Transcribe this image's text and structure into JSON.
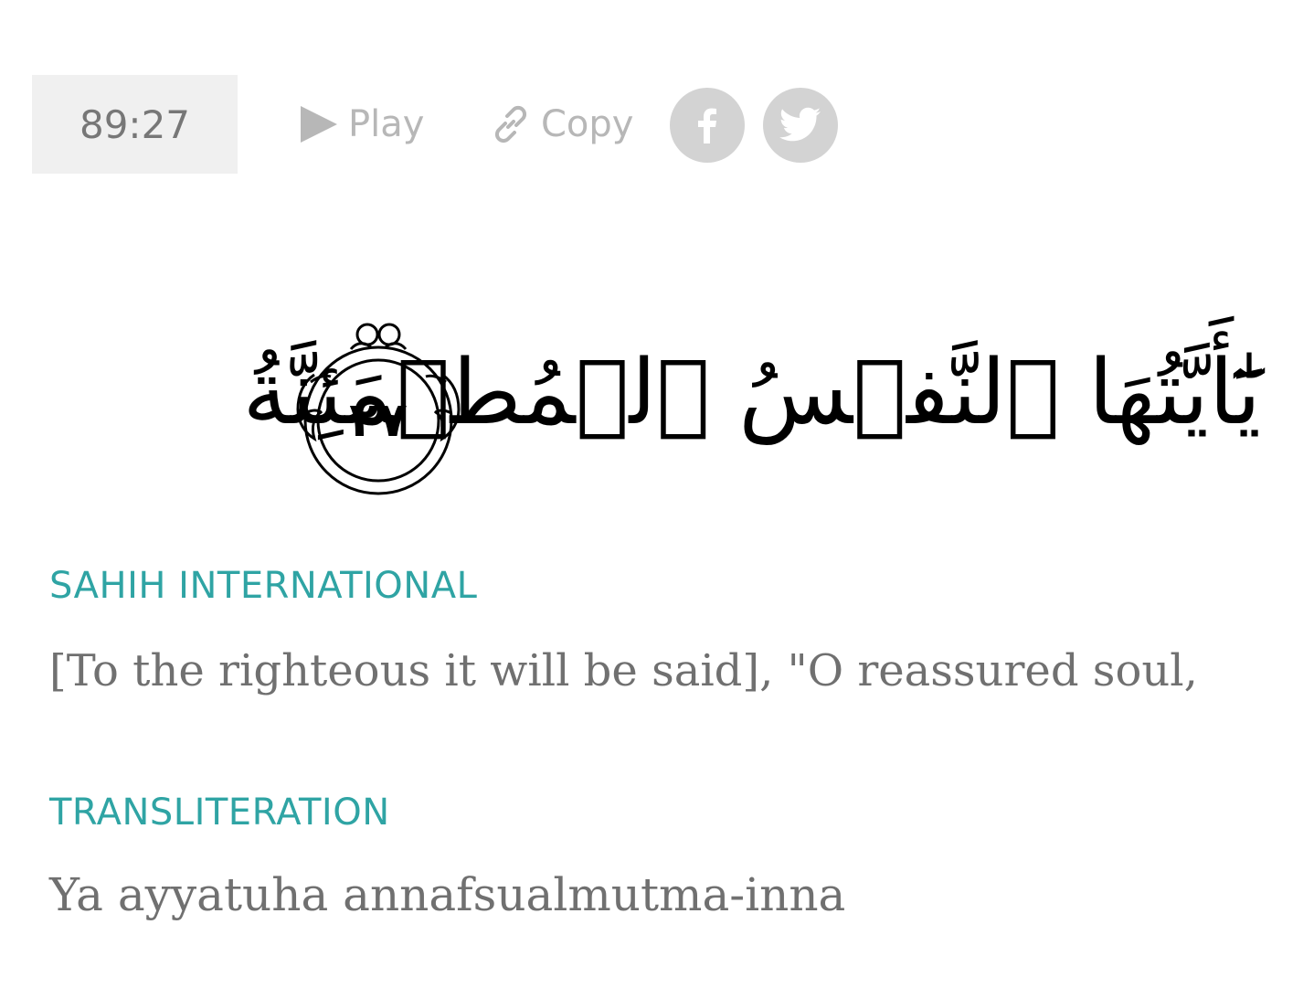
{
  "verse": {
    "key": "89:27",
    "arabic": "يَٰٓأَيَّتُهَا ٱلنَّفۡسُ ٱلۡمُطۡمَئِنَّةُ",
    "ayah_number": "٢٧"
  },
  "actions": {
    "play_label": "Play",
    "copy_label": "Copy"
  },
  "share": {
    "facebook_icon": "facebook-icon",
    "twitter_icon": "twitter-icon"
  },
  "translation": {
    "label": "SAHIH INTERNATIONAL",
    "text": "[To the righteous it will be said], \"O reassured soul,"
  },
  "transliteration": {
    "label": "TRANSLITERATION",
    "text": "Ya ayyatuha annafsualmutma-inna"
  },
  "colors": {
    "accent": "#2fa4a4",
    "muted": "#b7b7b7",
    "body_text": "#707070",
    "key_bg": "#f0f0f0",
    "social_bg": "#d3d3d3"
  }
}
